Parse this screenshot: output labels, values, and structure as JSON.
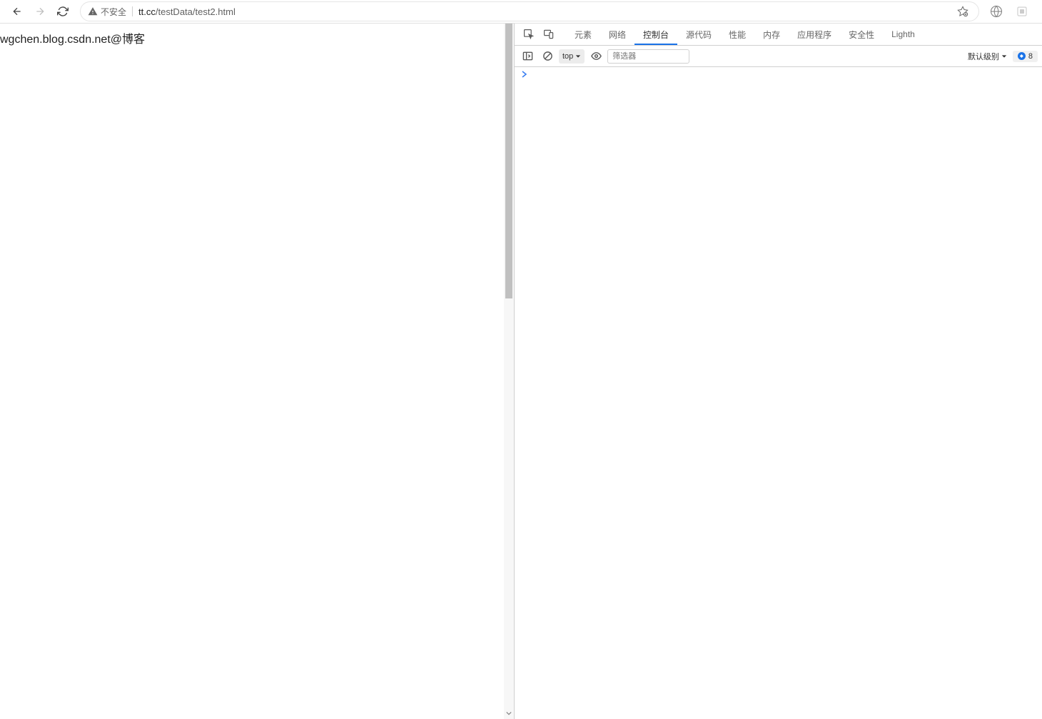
{
  "browser": {
    "security_label": "不安全",
    "url_host": "tt.cc",
    "url_path": "/testData/test2.html"
  },
  "page": {
    "text": "wgchen.blog.csdn.net@博客"
  },
  "devtools": {
    "tabs": [
      "元素",
      "网络",
      "控制台",
      "源代码",
      "性能",
      "内存",
      "应用程序",
      "安全性",
      "Lighth"
    ],
    "active_tab_index": 2,
    "console": {
      "context": "top",
      "filter_placeholder": "筛选器",
      "level_label": "默认级别",
      "issues_count": "8"
    }
  }
}
